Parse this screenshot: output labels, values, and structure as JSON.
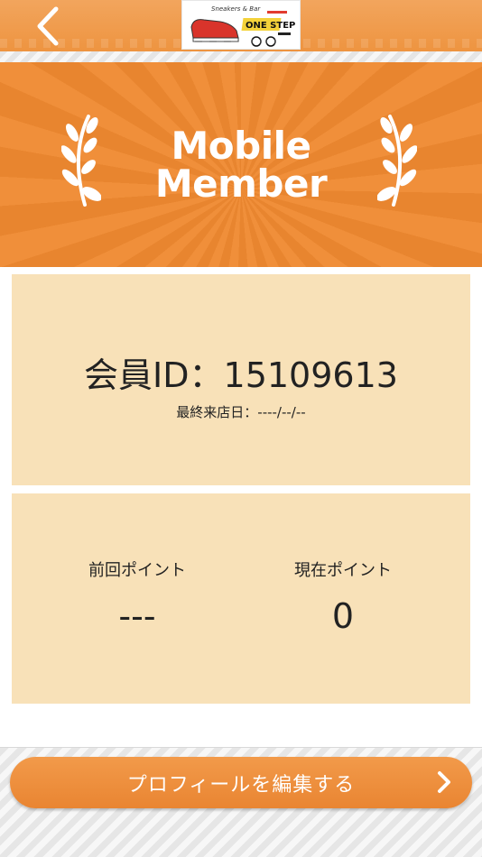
{
  "header": {
    "back_icon": "chevron-left-icon",
    "logo": {
      "line1": "Sneakers & Bar",
      "line2": "ONE STEP"
    }
  },
  "banner": {
    "title_line1": "Mobile",
    "title_line2": "Member"
  },
  "member": {
    "id_text": "会員ID：15109613",
    "last_visit": "最終来店日：----/--/--"
  },
  "points": {
    "previous_label": "前回ポイント",
    "previous_value": "---",
    "current_label": "現在ポイント",
    "current_value": "0"
  },
  "footer": {
    "edit_label": "プロフィールを編集する",
    "edit_icon": "chevron-right-icon"
  },
  "colors": {
    "orange": "#ee9440",
    "card_bg": "#f8e1b8",
    "white": "#ffffff"
  }
}
